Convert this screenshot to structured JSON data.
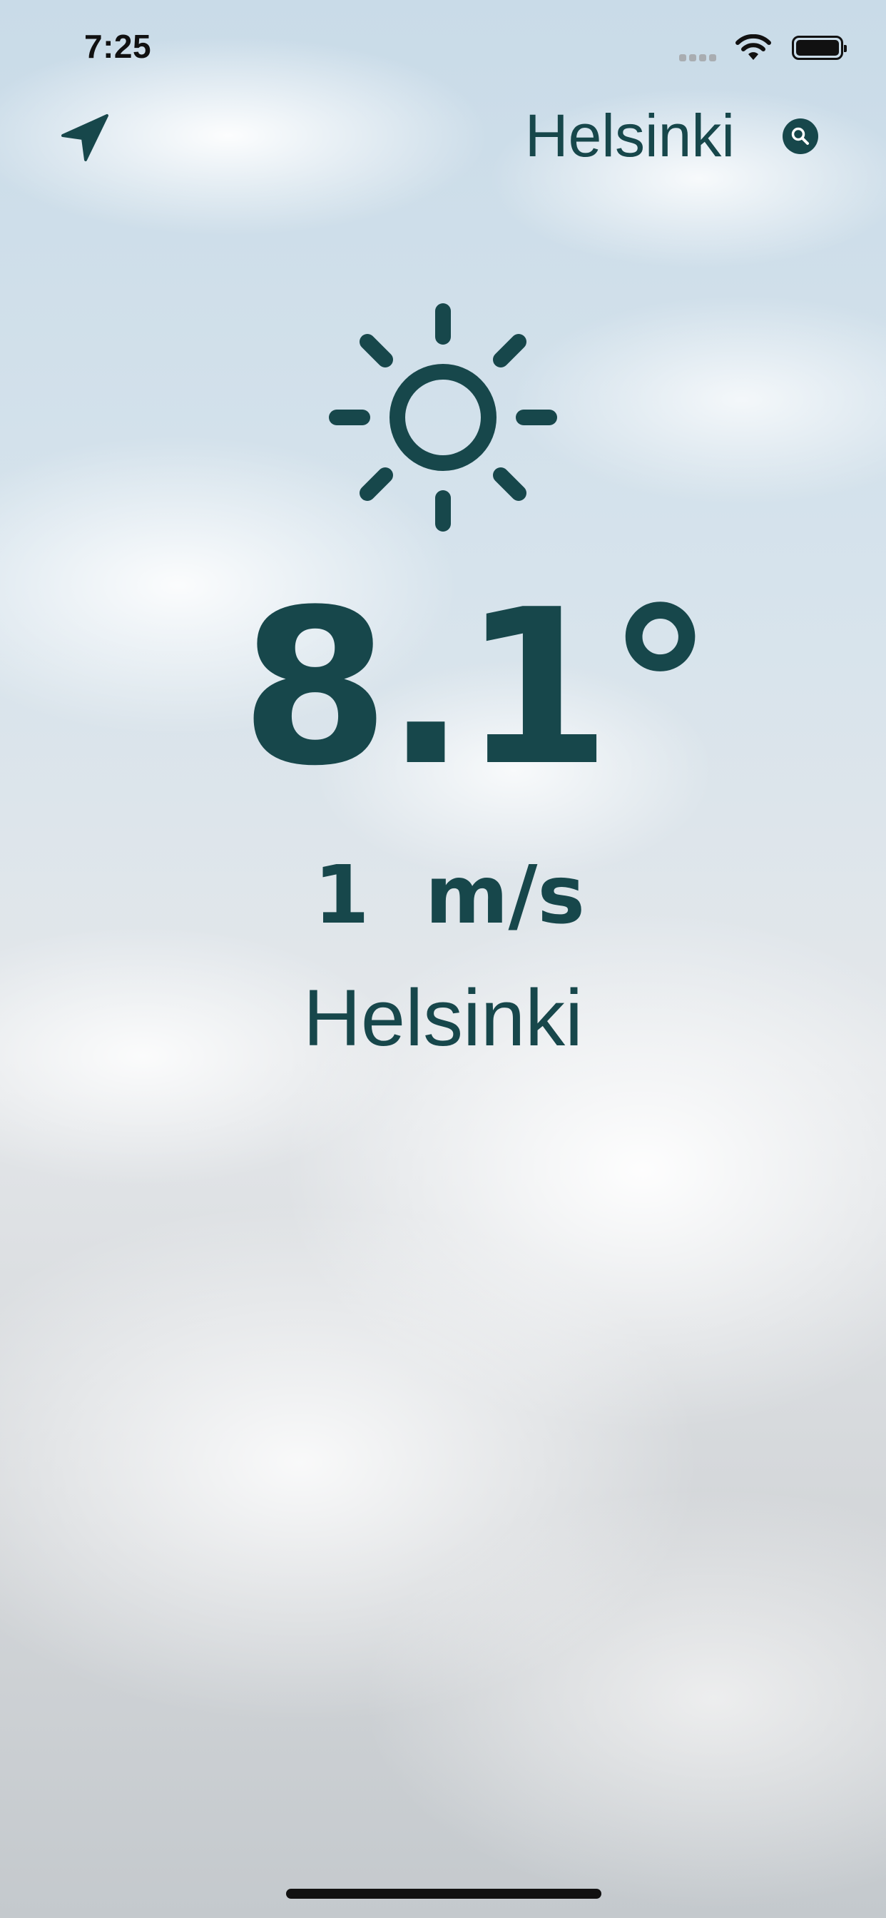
{
  "status_bar": {
    "time": "7:25"
  },
  "header": {
    "city": "Helsinki",
    "location_icon": "location-arrow-icon",
    "search_icon": "search-icon"
  },
  "weather": {
    "icon": "sun-icon",
    "temperature": "8.1°",
    "wind": "1  m/s",
    "city": "Helsinki"
  },
  "colors": {
    "primary_text": "#17474b",
    "background": "sky-clouds"
  }
}
